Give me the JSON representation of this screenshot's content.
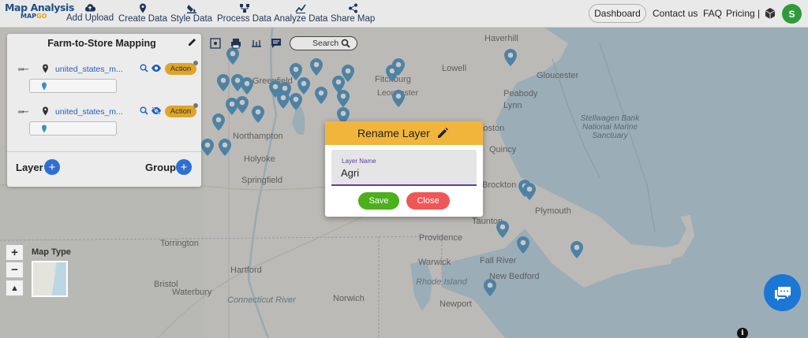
{
  "app": {
    "logo_title": "Map Analysis",
    "logo_sub_a": "MAP",
    "logo_sub_b": "GO"
  },
  "navbar": {
    "items": [
      {
        "label": "Add Upload",
        "icon": "cloud-upload-icon"
      },
      {
        "label": "Create Data",
        "icon": "map-pin-icon"
      },
      {
        "label": "Style Data",
        "icon": "paint-bucket-icon"
      },
      {
        "label": "Process Data",
        "icon": "process-nodes-icon"
      },
      {
        "label": "Analyze Data",
        "icon": "analyze-chart-icon"
      },
      {
        "label": "Share Map",
        "icon": "share-icon"
      }
    ],
    "dashboard": "Dashboard",
    "contact": "Contact us",
    "faq": "FAQ",
    "pricing": "Pricing |",
    "avatar_initial": "S"
  },
  "panel": {
    "title": "Farm-to-Store Mapping",
    "layers": [
      {
        "name": "united_states_m...",
        "action": "Action",
        "visible": true
      },
      {
        "name": "united_states_m...",
        "action": "Action",
        "visible": false
      }
    ],
    "layer_label": "Layer",
    "group_label": "Group"
  },
  "toolbar": {
    "search_placeholder": "Search"
  },
  "map": {
    "map_type_label": "Map Type",
    "cities": [
      "Haverhill",
      "Lowell",
      "Gloucester",
      "Fitchburg",
      "Leominster",
      "Peabody",
      "Lynn",
      "Greenfield",
      "Boston",
      "Northampton",
      "Quincy",
      "Holyoke",
      "Springfield",
      "Brockton",
      "Plymouth",
      "Taunton",
      "Providence",
      "Torrington",
      "Hartford",
      "Warwick",
      "Fall River",
      "New Bedford",
      "Bristol",
      "Waterbury",
      "Norwich",
      "Newport",
      "Rhode Island"
    ],
    "river_label": "Connecticut River",
    "sea_label": "Stellwagen Bank National Marine Sanctuary"
  },
  "dialog": {
    "title": "Rename Layer",
    "field_label": "Layer Name",
    "field_value": "Agri",
    "save": "Save",
    "close": "Close"
  },
  "colors": {
    "brand_blue": "#1e4f86",
    "accent_orange": "#f2b53c",
    "save_green": "#4caf1c",
    "close_red": "#ef5757",
    "pin_blue": "#3a8fc4"
  }
}
